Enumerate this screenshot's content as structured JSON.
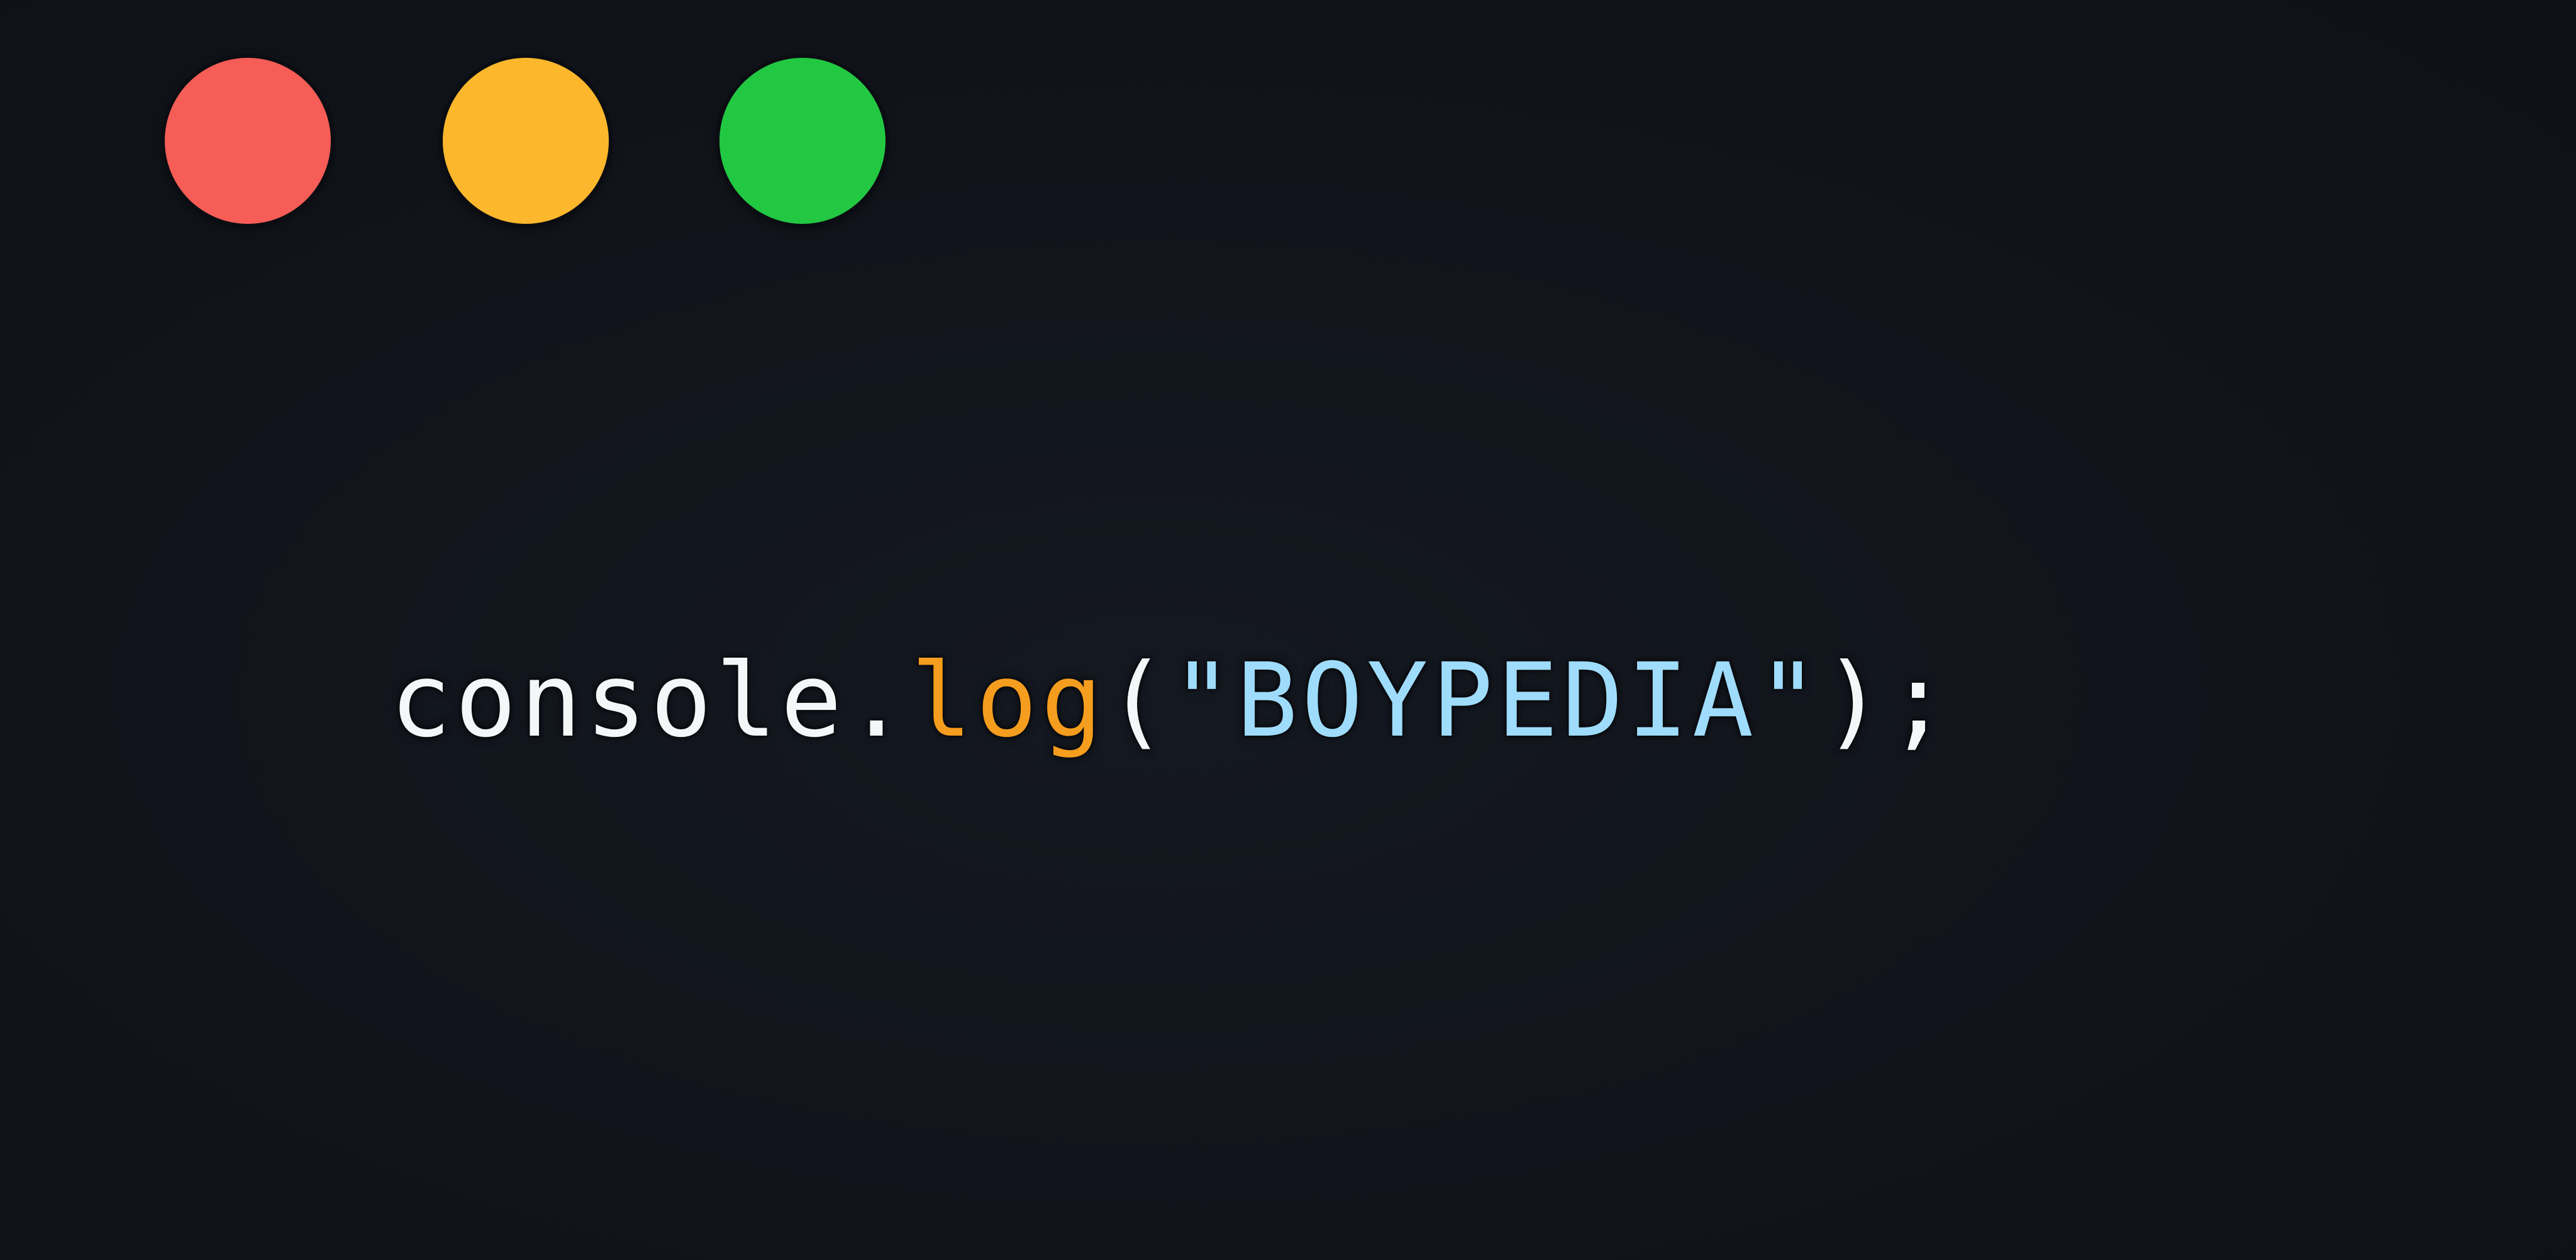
{
  "window": {
    "controls": [
      {
        "name": "close",
        "color": "#f55d56"
      },
      {
        "name": "minimize",
        "color": "#fcb72c"
      },
      {
        "name": "zoom",
        "color": "#22c842"
      }
    ]
  },
  "code": {
    "tokens": [
      {
        "text": "console",
        "color": "#f4f6f8"
      },
      {
        "text": ".",
        "color": "#f4f6f8"
      },
      {
        "text": "log",
        "color": "#f59d1e"
      },
      {
        "text": "(",
        "color": "#f4f6f8"
      },
      {
        "text": "\"BOYPEDIA\"",
        "color": "#9fdcfb"
      },
      {
        "text": ")",
        "color": "#f4f6f8"
      },
      {
        "text": ";",
        "color": "#f4f6f8"
      }
    ]
  }
}
